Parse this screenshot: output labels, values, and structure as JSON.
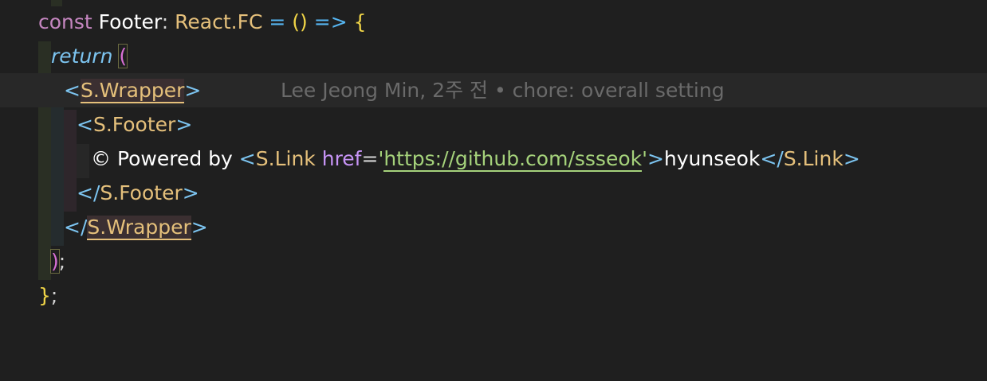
{
  "code": {
    "line1": {
      "const": "const",
      "name": "Footer",
      "colon": ":",
      "type": "React.FC",
      "eq": " = ",
      "parens": "()",
      "arrow": " => ",
      "brace": "{"
    },
    "line2": {
      "return": "return",
      "paren": "("
    },
    "line3": {
      "open": "<",
      "comp": "S.Wrapper",
      "close": ">"
    },
    "line4": {
      "open": "<",
      "comp": "S.Footer",
      "close": ">"
    },
    "line5": {
      "text": "© Powered by ",
      "open": "<",
      "comp": "S.Link",
      "attr": "href",
      "eq": "=",
      "quote1": "'",
      "url": "https://github.com/ssseok",
      "quote2": "'",
      "close": ">",
      "linktext": "hyunseok",
      "endopen": "</",
      "endcomp": "S.Link",
      "endclose": ">"
    },
    "line6": {
      "open": "</",
      "comp": "S.Footer",
      "close": ">"
    },
    "line7": {
      "open": "</",
      "comp": "S.Wrapper",
      "close": ">"
    },
    "line8": {
      "paren": ")",
      "semi": ";"
    },
    "line9": {
      "brace": "}",
      "semi": ";"
    }
  },
  "blame": {
    "text": "Lee Jeong Min, 2주 전 • chore: overall setting"
  }
}
